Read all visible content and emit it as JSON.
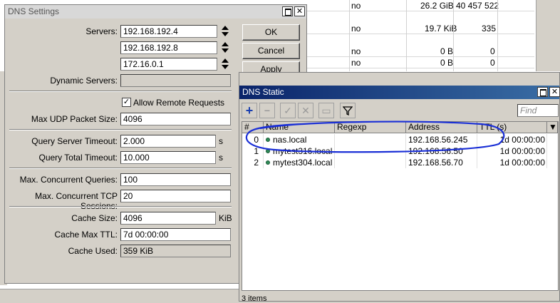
{
  "background_table": {
    "rows": [
      {
        "c1": "no",
        "c2": "26.2 GiB",
        "c3": "40 457 522"
      },
      {
        "c1": "no",
        "c2": "19.7 KiB",
        "c3": "335"
      },
      {
        "c1": "no",
        "c2": "0 B",
        "c3": "0"
      },
      {
        "c1": "no",
        "c2": "0 B",
        "c3": "0"
      }
    ]
  },
  "dns_settings": {
    "title": "DNS Settings",
    "servers_label": "Servers:",
    "servers": [
      "192.168.192.4",
      "192.168.192.8",
      "172.16.0.1"
    ],
    "dynamic_servers_label": "Dynamic Servers:",
    "dynamic_servers": "",
    "allow_remote_label": "Allow Remote Requests",
    "allow_remote_checked": "✓",
    "max_udp_label": "Max UDP Packet Size:",
    "max_udp": "4096",
    "query_server_timeout_label": "Query Server Timeout:",
    "query_server_timeout": "2.000",
    "query_total_timeout_label": "Query Total Timeout:",
    "query_total_timeout": "10.000",
    "seconds_unit": "s",
    "max_concurrent_queries_label": "Max. Concurrent Queries:",
    "max_concurrent_queries": "100",
    "max_concurrent_tcp_label": "Max. Concurrent TCP Sessions:",
    "max_concurrent_tcp": "20",
    "cache_size_label": "Cache Size:",
    "cache_size": "4096",
    "cache_size_unit": "KiB",
    "cache_max_ttl_label": "Cache Max TTL:",
    "cache_max_ttl": "7d 00:00:00",
    "cache_used_label": "Cache Used:",
    "cache_used": "359 KiB",
    "buttons": {
      "ok": "OK",
      "cancel": "Cancel",
      "apply": "Apply"
    }
  },
  "dns_static": {
    "title": "DNS Static",
    "find_placeholder": "Find",
    "columns": {
      "num": "#",
      "name": "Name",
      "regexp": "Regexp",
      "address": "Address",
      "ttl": "TTL (s)"
    },
    "rows": [
      {
        "num": "0",
        "name": "nas.local",
        "regexp": "",
        "address": "192.168.56.245",
        "ttl": "1d 00:00:00"
      },
      {
        "num": "1",
        "name": "mytest316.local",
        "regexp": "",
        "address": "192.168.56.50",
        "ttl": "1d 00:00:00"
      },
      {
        "num": "2",
        "name": "mytest304.local",
        "regexp": "",
        "address": "192.168.56.70",
        "ttl": "1d 00:00:00"
      }
    ],
    "status": "3 items",
    "icons": [
      "add-icon",
      "remove-icon",
      "enable-icon",
      "disable-icon",
      "comment-icon",
      "filter-icon"
    ]
  },
  "annotation_color": "#1a2fd6",
  "title_active_color": "#0a246a"
}
